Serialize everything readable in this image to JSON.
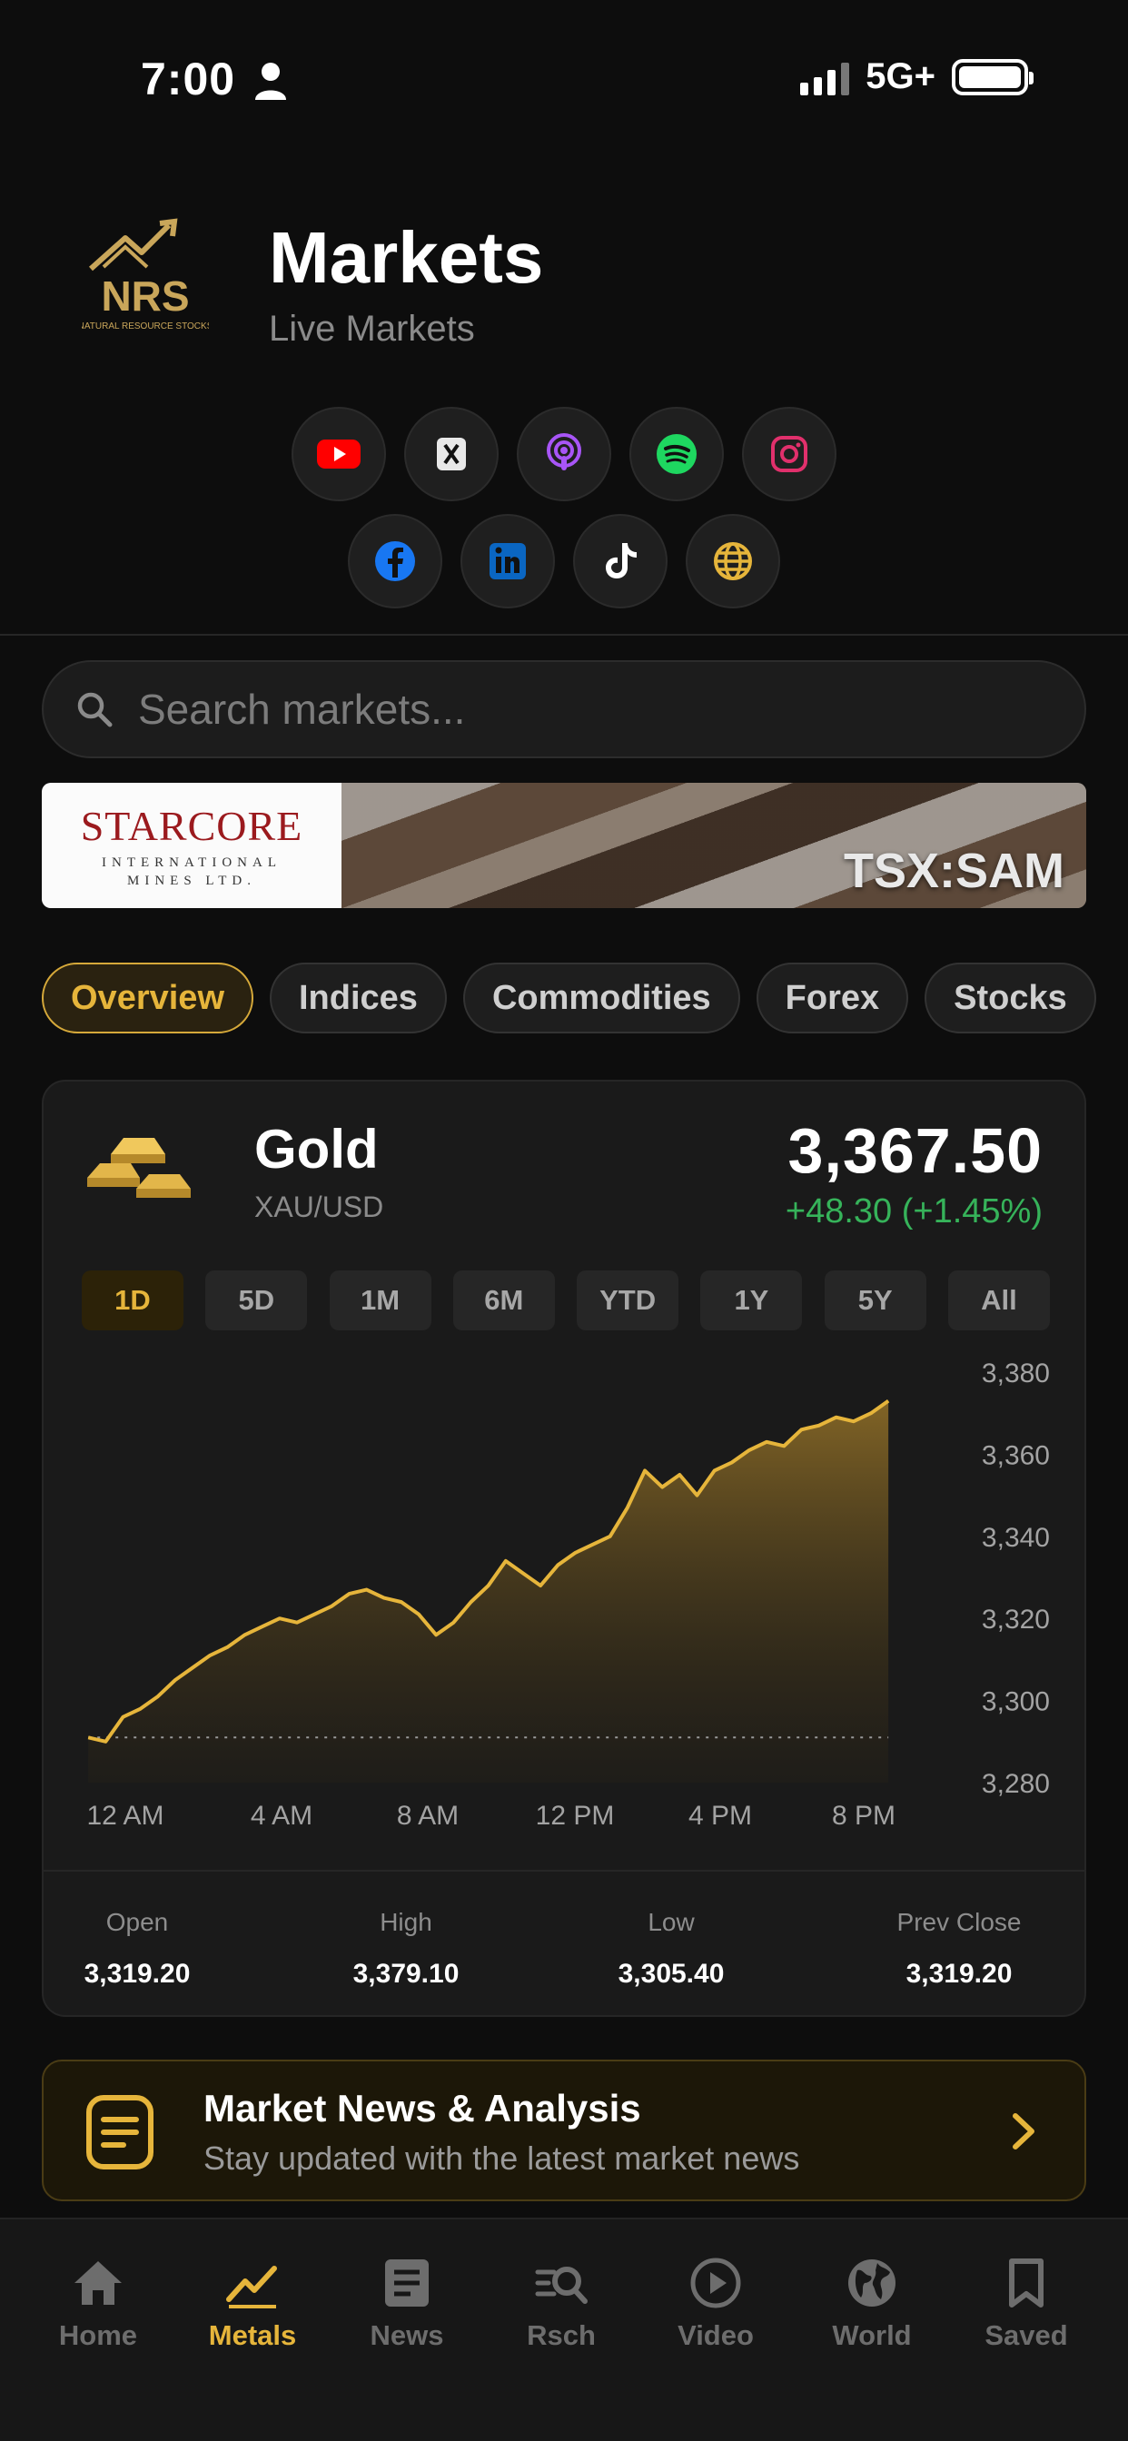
{
  "status_bar": {
    "time": "7:00",
    "network": "5G+"
  },
  "header": {
    "logo_text": "NRS",
    "logo_subtext": "NATURAL RESOURCE STOCKS",
    "title": "Markets",
    "subtitle": "Live Markets"
  },
  "social": {
    "row1": [
      "youtube-icon",
      "x-icon",
      "podcast-icon",
      "spotify-icon",
      "instagram-icon"
    ],
    "row2": [
      "facebook-icon",
      "linkedin-icon",
      "tiktok-icon",
      "globe-icon"
    ]
  },
  "search": {
    "placeholder": "Search markets..."
  },
  "banner": {
    "brand": "STARCORE",
    "brand_sub": "INTERNATIONAL MINES LTD.",
    "ticker": "TSX:SAM"
  },
  "tabs": [
    {
      "label": "Overview",
      "active": true
    },
    {
      "label": "Indices",
      "active": false
    },
    {
      "label": "Commodities",
      "active": false
    },
    {
      "label": "Forex",
      "active": false
    },
    {
      "label": "Stocks",
      "active": false
    }
  ],
  "asset": {
    "name": "Gold",
    "symbol": "XAU/USD",
    "price": "3,367.50",
    "change": "+48.30 (+1.45%)"
  },
  "ranges": [
    "1D",
    "5D",
    "1M",
    "6M",
    "YTD",
    "1Y",
    "5Y",
    "All"
  ],
  "active_range": "1D",
  "stats": {
    "open_label": "Open",
    "open_value": "3,319.20",
    "high_label": "High",
    "high_value": "3,379.10",
    "low_label": "Low",
    "low_value": "3,305.40",
    "prev_label": "Prev Close",
    "prev_value": "3,319.20"
  },
  "chart_data": {
    "type": "area",
    "title": "",
    "xlabel": "",
    "ylabel": "",
    "x_ticks": [
      "12 AM",
      "4 AM",
      "8 AM",
      "12 PM",
      "4 PM",
      "8 PM"
    ],
    "y_ticks": [
      3380,
      3360,
      3340,
      3320,
      3300,
      3280
    ],
    "ylim": [
      3280,
      3380
    ],
    "x_hours": [
      0,
      0.5,
      1,
      1.5,
      2,
      2.5,
      3,
      3.5,
      4,
      4.5,
      5,
      5.5,
      6,
      6.5,
      7,
      7.5,
      8,
      8.5,
      9,
      9.5,
      10,
      10.5,
      11,
      11.5,
      12,
      12.5,
      13,
      13.5,
      14,
      14.5,
      15,
      15.5,
      16,
      16.5,
      17,
      17.5,
      18,
      18.5,
      19,
      19.5,
      20,
      20.5,
      21,
      21.5,
      22,
      22.5,
      23
    ],
    "values": [
      3291,
      3290,
      3296,
      3298,
      3301,
      3305,
      3308,
      3311,
      3313,
      3316,
      3318,
      3320,
      3319,
      3321,
      3323,
      3326,
      3327,
      3325,
      3324,
      3321,
      3316,
      3319,
      3324,
      3328,
      3334,
      3331,
      3328,
      3333,
      3336,
      3338,
      3340,
      3347,
      3356,
      3352,
      3355,
      3350,
      3356,
      3358,
      3361,
      3363,
      3362,
      3366,
      3367,
      3369,
      3368,
      3370,
      3373
    ],
    "baseline": 3291,
    "line_color": "#e6b53b",
    "grid": false
  },
  "news": {
    "title": "Market News & Analysis",
    "subtitle": "Stay updated with the latest market news"
  },
  "nav": [
    {
      "label": "Home",
      "icon": "home-icon",
      "active": false
    },
    {
      "label": "Metals",
      "icon": "trend-icon",
      "active": true
    },
    {
      "label": "News",
      "icon": "newspaper-icon",
      "active": false
    },
    {
      "label": "Rsch",
      "icon": "research-icon",
      "active": false
    },
    {
      "label": "Video",
      "icon": "play-icon",
      "active": false
    },
    {
      "label": "World",
      "icon": "globe-icon",
      "active": false
    },
    {
      "label": "Saved",
      "icon": "bookmark-icon",
      "active": false
    }
  ],
  "colors": {
    "accent": "#e6b53b",
    "positive": "#36b35a",
    "background": "#0d0d0d"
  }
}
